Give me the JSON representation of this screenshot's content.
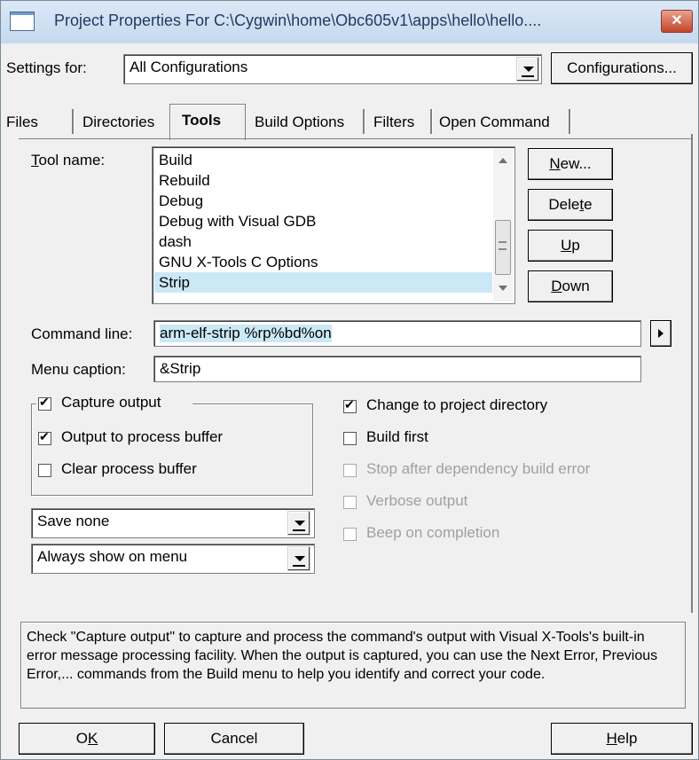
{
  "window": {
    "title": "Project Properties For C:\\Cygwin\\home\\Obc605v1\\apps\\hello\\hello....",
    "close_label": "✕"
  },
  "settings": {
    "label": "Settings for:",
    "value": "All Configurations",
    "configurations_button": "Configurations..."
  },
  "tabs": [
    {
      "label": "Files",
      "active": false
    },
    {
      "label": "Directories",
      "active": false
    },
    {
      "label": "Tools",
      "active": true
    },
    {
      "label": "Build Options",
      "active": false
    },
    {
      "label": "Filters",
      "active": false
    },
    {
      "label": "Open Command",
      "active": false
    }
  ],
  "tools": {
    "tool_name_label_first": "T",
    "tool_name_label_rest": "ool name:",
    "items": [
      "Build",
      "Rebuild",
      "Debug",
      "Debug with Visual GDB",
      "dash",
      "GNU X-Tools C Options",
      "Strip"
    ],
    "selected_index": 6,
    "buttons": {
      "new_first": "N",
      "new_rest": "ew...",
      "delete_pre": "Dele",
      "delete_ul": "t",
      "delete_post": "e",
      "up_first": "U",
      "up_rest": "p",
      "down_first": "D",
      "down_rest": "own"
    }
  },
  "command_line": {
    "label": "Command line:",
    "value": "arm-elf-strip %rp%bd%on"
  },
  "menu_caption": {
    "label": "Menu caption:",
    "value": "&Strip"
  },
  "options_left": {
    "capture_output": {
      "label": "Capture output",
      "checked": true
    },
    "output_to_buffer": {
      "label": "Output to process buffer",
      "checked": true
    },
    "clear_buffer": {
      "label": "Clear process buffer",
      "checked": false
    }
  },
  "options_right": {
    "change_dir": {
      "label": "Change to project directory",
      "checked": true,
      "enabled": true
    },
    "build_first": {
      "label": "Build first",
      "checked": false,
      "enabled": true
    },
    "stop_after": {
      "label": "Stop after dependency build error",
      "checked": false,
      "enabled": false
    },
    "verbose": {
      "label": "Verbose output",
      "checked": false,
      "enabled": false
    },
    "beep": {
      "label": "Beep on completion",
      "checked": false,
      "enabled": false
    }
  },
  "save_select": {
    "value": "Save none"
  },
  "show_select": {
    "value": "Always show on menu"
  },
  "help_text": "Check \"Capture output\" to capture and process the command's output with Visual X-Tools's built-in error message processing facility.  When the output is captured, you can use the Next Error, Previous Error,... commands from the Build menu to help you identify and correct your code.",
  "footer": {
    "ok_pre": "O",
    "ok_ul": "K",
    "cancel": "Cancel",
    "help_first": "H",
    "help_rest": "elp"
  }
}
